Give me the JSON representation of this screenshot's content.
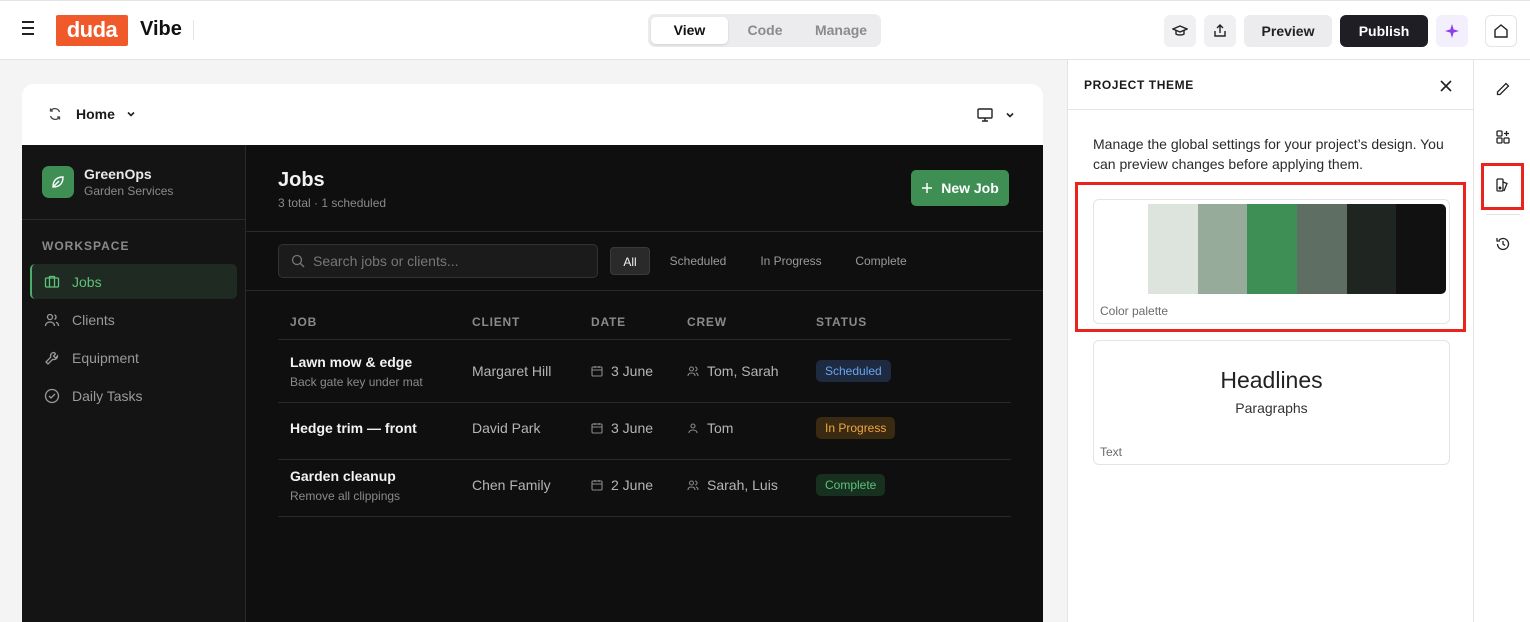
{
  "topbar": {
    "logo": "duda",
    "app_name": "Vibe",
    "modes": [
      "View",
      "Code",
      "Manage"
    ],
    "active_mode": "View",
    "preview_label": "Preview",
    "publish_label": "Publish"
  },
  "canvas": {
    "page": "Home"
  },
  "app": {
    "brand_name": "GreenOps",
    "brand_sub": "Garden Services",
    "workspace_label": "WORKSPACE",
    "nav": [
      "Jobs",
      "Clients",
      "Equipment",
      "Daily Tasks"
    ],
    "active_nav": "Jobs",
    "title": "Jobs",
    "subtitle": "3 total · 1 scheduled",
    "new_job_label": "New Job",
    "search_placeholder": "Search jobs or clients...",
    "filters": [
      "All",
      "Scheduled",
      "In Progress",
      "Complete"
    ],
    "columns": [
      "JOB",
      "CLIENT",
      "DATE",
      "CREW",
      "STATUS"
    ],
    "rows": [
      {
        "job": "Lawn mow & edge",
        "note": "Back gate key under mat",
        "client": "Margaret Hill",
        "date": "3 June",
        "crew": "Tom, Sarah",
        "status": "Scheduled"
      },
      {
        "job": "Hedge trim — front",
        "note": "",
        "client": "David Park",
        "date": "3 June",
        "crew": "Tom",
        "status": "In Progress"
      },
      {
        "job": "Garden cleanup",
        "note": "Remove all clippings",
        "client": "Chen Family",
        "date": "2 June",
        "crew": "Sarah, Luis",
        "status": "Complete"
      }
    ]
  },
  "panel": {
    "title": "PROJECT THEME",
    "description": "Manage the global settings for your project’s design. You can preview changes before applying them.",
    "palette_label": "Color palette",
    "palette_colors": [
      "#ffffff",
      "#dde3dd",
      "#97ab9b",
      "#3e8f56",
      "#5f6e63",
      "#1f2520",
      "#111111"
    ],
    "text_card": {
      "headline": "Headlines",
      "paragraph": "Paragraphs",
      "label": "Text"
    }
  },
  "colors": {
    "brand": "#f05a2a",
    "accent_green": "#3f8f55",
    "highlight_red": "#e8241c"
  }
}
